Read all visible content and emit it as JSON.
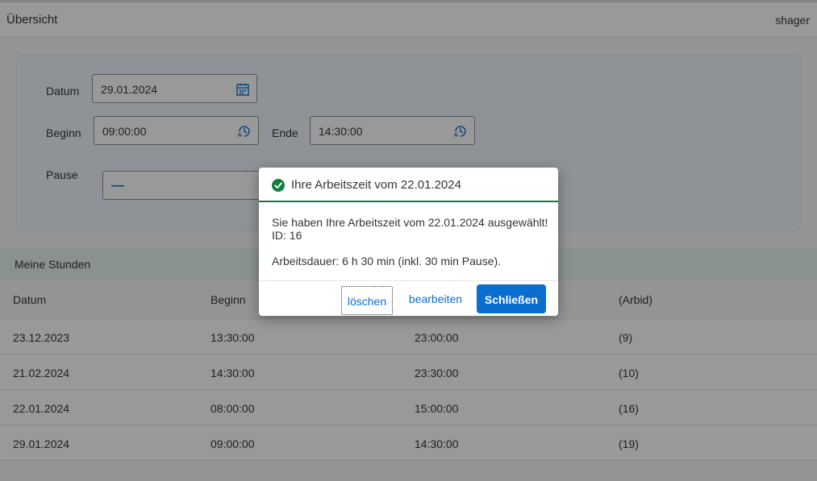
{
  "shell": {
    "title": "Übersicht",
    "user": "shager"
  },
  "form": {
    "date_label": "Datum",
    "date_value": "29.01.2024",
    "start_label": "Beginn",
    "start_value": "09:00:00",
    "end_label": "Ende",
    "end_value": "14:30:00",
    "break_label": "Pause",
    "break_value": "—"
  },
  "hours": {
    "title": "Meine Stunden",
    "columns": [
      "Datum",
      "Beginn",
      "",
      "(Arbid)"
    ],
    "rows": [
      [
        "23.12.2023",
        "13:30:00",
        "23:00:00",
        "(9)"
      ],
      [
        "21.02.2024",
        "14:30:00",
        "23:30:00",
        "(10)"
      ],
      [
        "22.01.2024",
        "08:00:00",
        "15:00:00",
        "(16)"
      ],
      [
        "29.01.2024",
        "09:00:00",
        "14:30:00",
        "(19)"
      ]
    ]
  },
  "dialog": {
    "title": "Ihre Arbeitszeit vom 22.01.2024",
    "line1": "Sie haben Ihre Arbeitszeit vom 22.01.2024 ausgewählt!",
    "line2": "ID: 16",
    "line3": "Arbeitsdauer: 6 h 30 min (inkl. 30 min Pause).",
    "delete_label": "löschen",
    "edit_label": "bearbeiten",
    "close_label": "Schließen"
  },
  "colors": {
    "accent": "#0a6ed1",
    "success": "#107e3e"
  },
  "icons": {
    "date": "calendar-icon",
    "time": "time-icon",
    "dialog": "success-check-icon"
  }
}
